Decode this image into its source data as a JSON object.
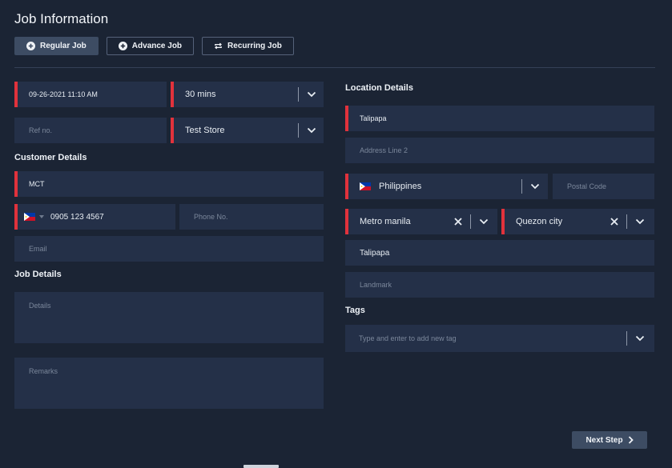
{
  "page": {
    "title": "Job Information"
  },
  "tabs": [
    {
      "label": "Regular Job",
      "icon": "plus-circle-icon",
      "active": true
    },
    {
      "label": "Advance Job",
      "icon": "plus-circle-icon",
      "active": false
    },
    {
      "label": "Recurring Job",
      "icon": "repeat-icon",
      "active": false
    }
  ],
  "schedule": {
    "datetime": "09-26-2021 11:10 AM",
    "duration": "30 mins",
    "ref_placeholder": "Ref no.",
    "store": "Test Store"
  },
  "customer": {
    "heading": "Customer Details",
    "name": "MCT",
    "mobile": "0905 123 4567",
    "phone_placeholder": "Phone No.",
    "email_placeholder": "Email"
  },
  "job": {
    "heading": "Job Details",
    "details_placeholder": "Details",
    "remarks_placeholder": "Remarks"
  },
  "location": {
    "heading": "Location Details",
    "address_line1": "Talipapa",
    "address_line2_placeholder": "Address Line 2",
    "country": "Philippines",
    "postal_placeholder": "Postal Code",
    "region": "Metro manila",
    "city": "Quezon city",
    "barangay": "Talipapa",
    "landmark_placeholder": "Landmark"
  },
  "tags": {
    "heading": "Tags",
    "placeholder": "Type and enter to add new tag"
  },
  "footer": {
    "next_label": "Next Step"
  },
  "colors": {
    "background": "#1b2434",
    "field": "#243048",
    "required": "#e1323c",
    "button": "#3d4c63"
  }
}
